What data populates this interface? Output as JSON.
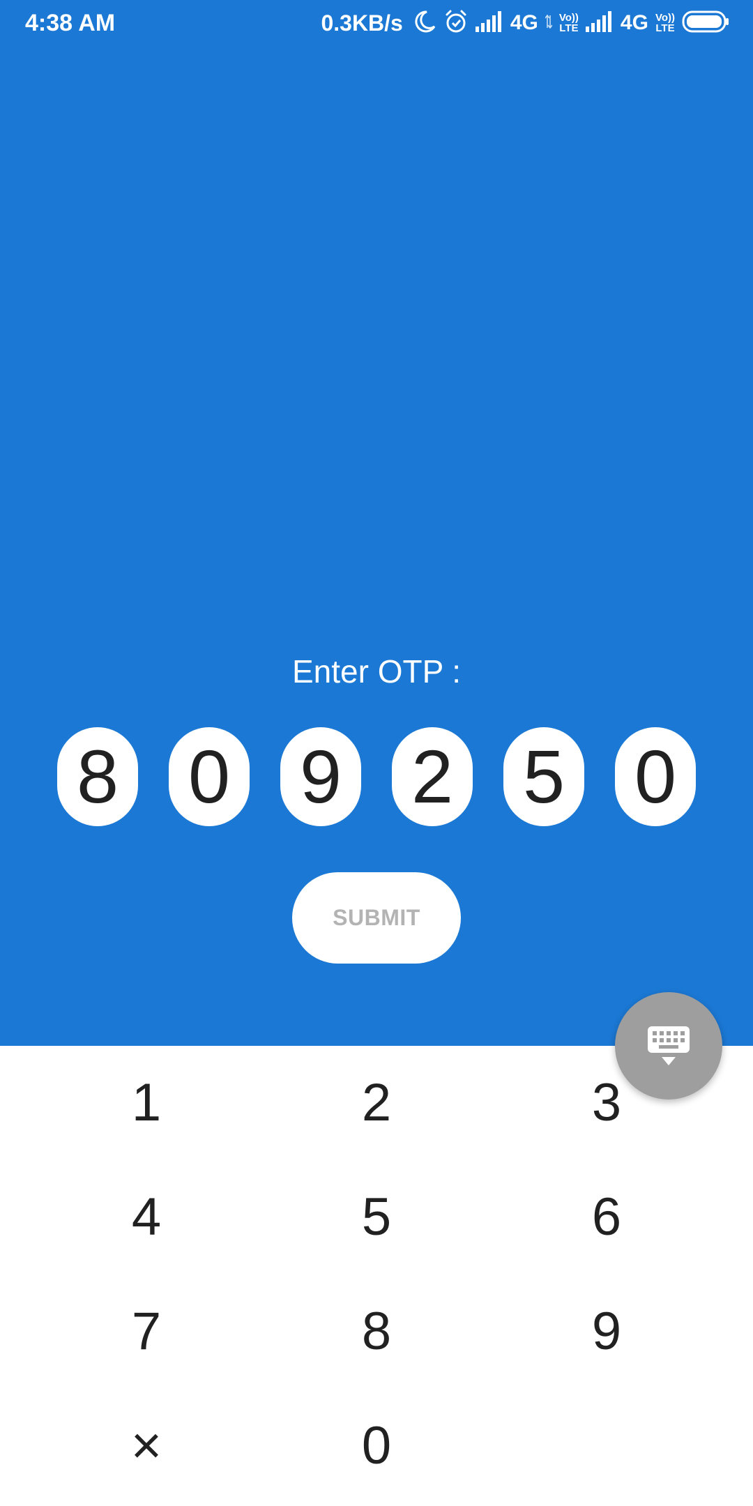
{
  "status_bar": {
    "time": "4:38 AM",
    "net_speed": "0.3KB/s",
    "sim1_network": "4G",
    "sim2_network": "4G",
    "volte_top": "Vo))",
    "volte_bottom": "LTE",
    "icons": [
      "moon-icon",
      "alarm-icon",
      "signal-icon",
      "data-arrows-icon",
      "volte-icon",
      "signal-icon",
      "volte-icon",
      "battery-icon"
    ]
  },
  "otp": {
    "label": "Enter OTP :",
    "digits": [
      "8",
      "0",
      "9",
      "2",
      "5",
      "0"
    ]
  },
  "submit": {
    "label": "SUBMIT"
  },
  "keypad": {
    "keys": [
      "1",
      "2",
      "3",
      "4",
      "5",
      "6",
      "7",
      "8",
      "9",
      "×",
      "0"
    ]
  },
  "keyboard_toggle": {
    "icon": "keyboard-hide-icon"
  },
  "colors": {
    "primary_blue": "#1b78d4",
    "fab_grey": "#9e9e9e",
    "submit_text": "#b3b3b3",
    "digit_text": "#212121"
  }
}
